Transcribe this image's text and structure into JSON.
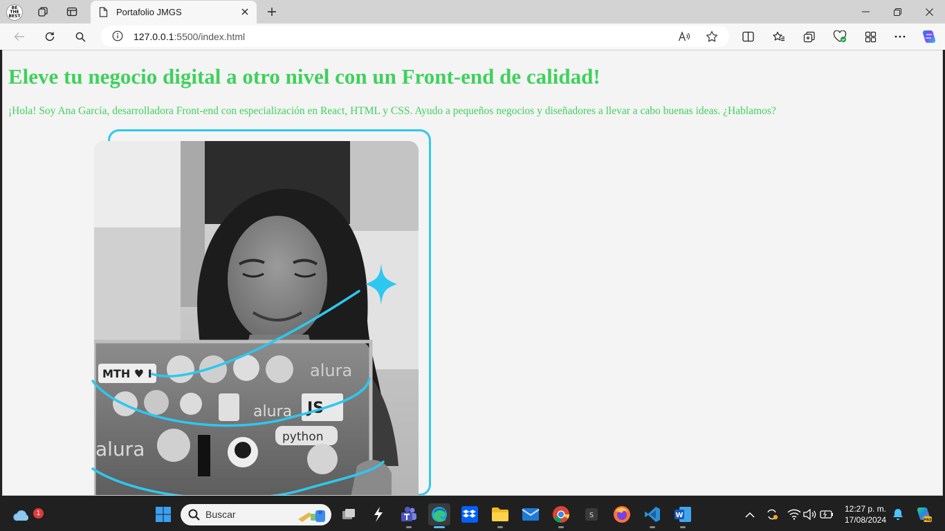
{
  "browser": {
    "profile_badge": "BE THE BEST",
    "tab": {
      "title": "Portafolio JMGS"
    },
    "address": {
      "host": "127.0.0.1",
      "path": ":5500/index.html"
    },
    "read_aloud_label": "A̩"
  },
  "page": {
    "title": "Eleve tu negocio digital a otro nivel con un Front-end de calidad!",
    "subtitle": "¡Hola! Soy Ana García, desarrolladora Front-end con especialización en React, HTML y CSS. Ayudo a pequeños negocios y diseñadores a llevar a cabo buenas ideas. ¿Hablamos?",
    "text_color": "#3fd15c",
    "accent_color": "#2ec7ef",
    "laptop_stickers": [
      "MTH ♥ I",
      "alura",
      "JS",
      "alura",
      "python",
      "alura"
    ]
  },
  "taskbar": {
    "weather_badge": "1",
    "search_placeholder": "Buscar",
    "time": "12:27 p. m.",
    "date": "17/08/2024"
  }
}
